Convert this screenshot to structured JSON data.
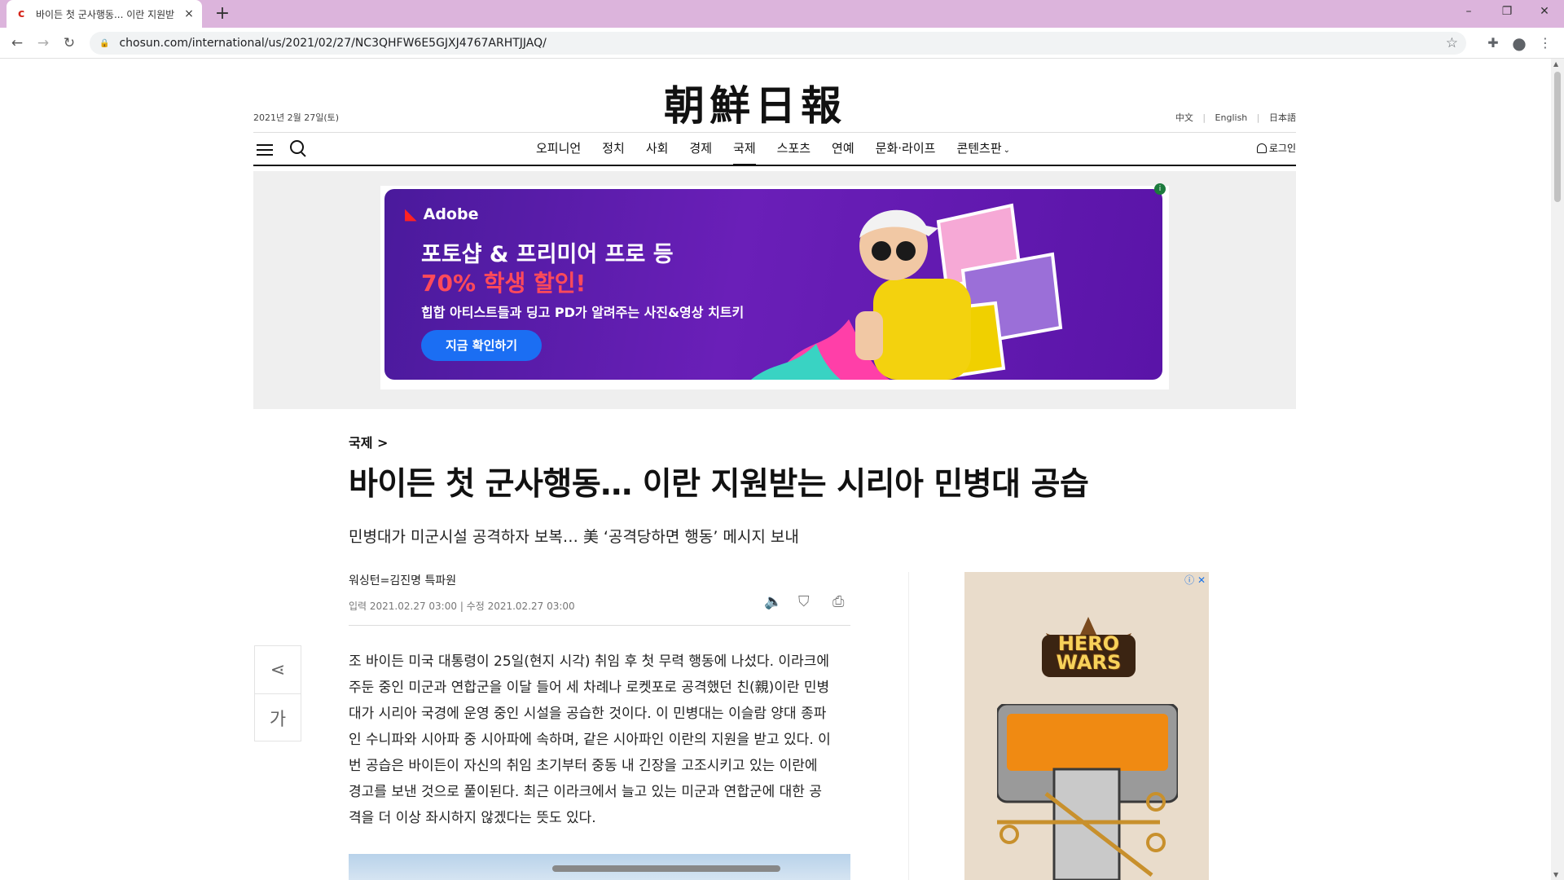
{
  "browser": {
    "tab_title": "바이든 첫 군사행동... 이란 지원받",
    "tab_close": "×",
    "new_tab": "+",
    "url": "chosun.com/international/us/2021/02/27/NC3QHFW6E5GJXJ4767ARHTJJAQ/",
    "window_controls": [
      "–",
      "❐",
      "✕"
    ]
  },
  "page": {
    "logo": "朝鮮日報",
    "date": "2021년 2월 27일(토)",
    "languages": [
      "中文",
      "English",
      "日本語"
    ],
    "nav": [
      "오피니언",
      "정치",
      "사회",
      "경제",
      "국제",
      "스포츠",
      "연예",
      "문화·라이프",
      "콘텐츠판"
    ],
    "nav_active": "국제",
    "login": "로그인"
  },
  "ad": {
    "brand": "Adobe",
    "line1": "포토샵 & 프리미어 프로 등",
    "line2": "70% 학생 할인!",
    "line3": "힙합 아티스트들과 딩고 PD가 알려주는 사진&영상 치트키",
    "cta": "지금 확인하기",
    "info": "i"
  },
  "article": {
    "category": "국제 >",
    "headline": "바이든 첫 군사행동… 이란 지원받는 시리아 민병대 공습",
    "subhead": "민병대가 미군시설 공격하자 보복… 美 ‘공격당하면 행동’ 메시지 보내",
    "byline": "워싱턴=김진명 특파원",
    "dates": "입력 2021.02.27 03:00 | 수정 2021.02.27 03:00",
    "body": [
      "조 바이든 미국 대통령이 25일(현지 시각) 취임 후 첫 무력 행동에 나섰다. 이라크에",
      "주둔 중인 미군과 연합군을 이달 들어 세 차례나 로켓포로 공격했던 친(親)이란 민병",
      "대가 시리아 국경에 운영 중인 시설을 공습한 것이다. 이 민병대는 이슬람 양대 종파",
      "인 수니파와 시아파 중 시아파에 속하며, 같은 시아파인 이란의 지원을 받고 있다. 이",
      "번 공습은 바이든이 자신의 취임 초기부터 중동 내 긴장을 고조시키고 있는 이란에",
      "경고를 보낸 것으로 풀이된다. 최근 이라크에서 늘고 있는 미군과 연합군에 대한 공",
      "격을 더 이상 좌시하지 않겠다는 뜻도 있다."
    ],
    "font_button": "가"
  },
  "side_ad": {
    "title": "HERO WARS",
    "choices": "ⓘ ✕"
  }
}
